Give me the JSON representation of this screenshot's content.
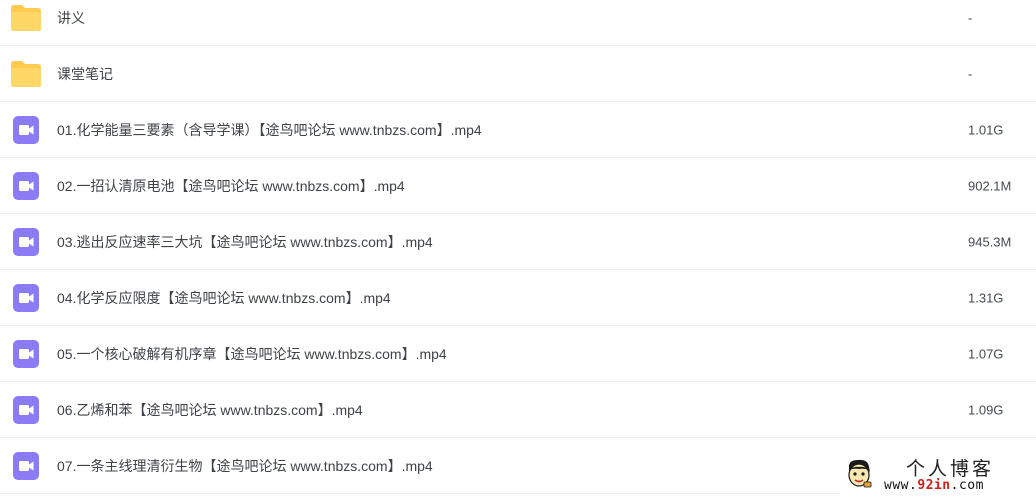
{
  "files": [
    {
      "type": "folder",
      "name": "讲义",
      "size": "-"
    },
    {
      "type": "folder",
      "name": "课堂笔记",
      "size": "-"
    },
    {
      "type": "video",
      "name": "01.化学能量三要素（含导学课）【途鸟吧论坛 www.tnbzs.com】.mp4",
      "size": "1.01G"
    },
    {
      "type": "video",
      "name": "02.一招认清原电池【途鸟吧论坛 www.tnbzs.com】.mp4",
      "size": "902.1M"
    },
    {
      "type": "video",
      "name": "03.逃出反应速率三大坑【途鸟吧论坛 www.tnbzs.com】.mp4",
      "size": "945.3M"
    },
    {
      "type": "video",
      "name": "04.化学反应限度【途鸟吧论坛 www.tnbzs.com】.mp4",
      "size": "1.31G"
    },
    {
      "type": "video",
      "name": "05.一个核心破解有机序章【途鸟吧论坛 www.tnbzs.com】.mp4",
      "size": "1.07G"
    },
    {
      "type": "video",
      "name": "06.乙烯和苯【途鸟吧论坛 www.tnbzs.com】.mp4",
      "size": "1.09G"
    },
    {
      "type": "video",
      "name": "07.一条主线理清衍生物【途鸟吧论坛 www.tnbzs.com】.mp4",
      "size": ""
    }
  ],
  "icons": {
    "folder": "folder-icon",
    "video": "video-file-icon"
  },
  "colors": {
    "folder_yellow": "#FFCB4E",
    "video_purple": "#8B7CF6",
    "row_border": "#EEF0F4"
  },
  "watermark": {
    "title": "个人博客",
    "url_prefix": "www.",
    "url_accent": "92in",
    "url_suffix": ".com"
  }
}
